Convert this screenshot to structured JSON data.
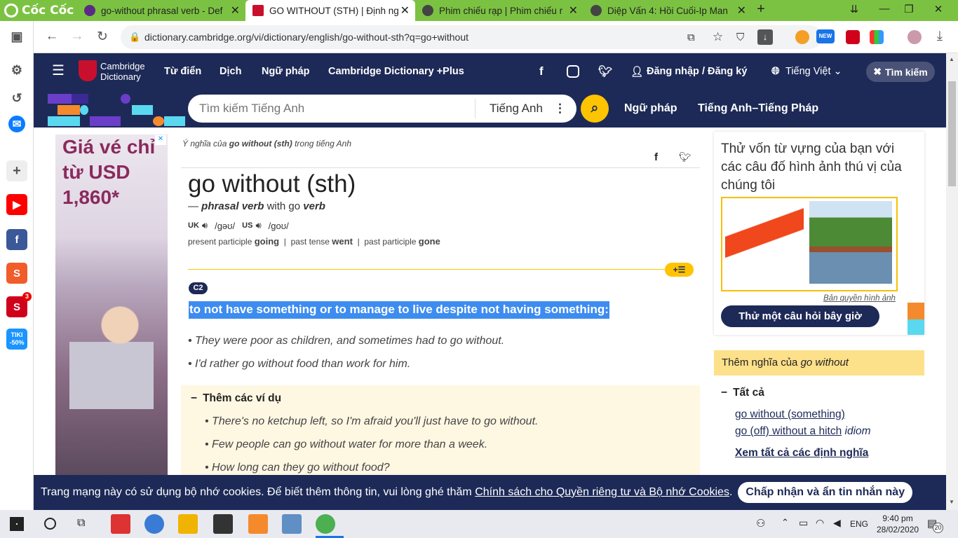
{
  "browser": {
    "brand": "Cốc Cốc",
    "tabs": [
      {
        "title": "go-without phrasal verb - Def"
      },
      {
        "title": "GO WITHOUT (STH) | Định ng"
      },
      {
        "title": "Phim chiếu rạp | Phim chiếu r"
      },
      {
        "title": "Diệp Vấn 4: Hồi Cuối-Ip Man"
      }
    ],
    "url": "dictionary.cambridge.org/vi/dictionary/english/go-without-sth?q=go+without",
    "ext_badge": "NEW"
  },
  "sidebar": {
    "shopee_badge": "3",
    "tiki_label": "TIKI",
    "tiki_discount": "-50%"
  },
  "header": {
    "logo_line1": "Cambridge",
    "logo_line2": "Dictionary",
    "nav": [
      "Từ điển",
      "Dịch",
      "Ngữ pháp",
      "Cambridge Dictionary +Plus"
    ],
    "login": "Đăng nhập / Đăng ký",
    "language": "Tiếng Việt",
    "close_search": "Tìm kiếm"
  },
  "search": {
    "placeholder": "Tìm kiếm Tiếng Anh",
    "lang": "Tiếng Anh",
    "links": [
      "Ngữ pháp",
      "Tiếng Anh–Tiếng Pháp"
    ]
  },
  "ad": {
    "line1": "Giá vé chỉ",
    "line2": "từ USD",
    "line3": "1,860*"
  },
  "entry": {
    "meaning_prefix": "Ý nghĩa của",
    "meaning_word": "go without (sth)",
    "meaning_suffix": "trong tiếng Anh",
    "headword": "go without (sth)",
    "pos_dash": "—",
    "pos": "phrasal verb",
    "pos_with": "with go",
    "pos_verb": "verb",
    "uk_label": "UK",
    "uk_ipa": "/ɡəʊ/",
    "us_label": "US",
    "us_ipa": "/ɡoʊ/",
    "forms": [
      {
        "label": "present participle",
        "value": "going"
      },
      {
        "label": "past tense",
        "value": "went"
      },
      {
        "label": "past participle",
        "value": "gone"
      }
    ],
    "level": "C2",
    "definition": "to not have something or to manage to live despite not having something:",
    "examples": [
      "They were poor as children, and sometimes had to go without.",
      "I'd rather go without food than work for him."
    ],
    "more_title": "Thêm các ví dụ",
    "more_examples": [
      "There's no ketchup left, so I'm afraid you'll just have to go without.",
      "Few people can go without water for more than a week.",
      "How long can they go without food?"
    ]
  },
  "right": {
    "quiz_text": "Thử vốn từ vựng của bạn với các câu đố hình ảnh thú vị của chúng tôi",
    "credit": "Bản quyền hình ảnh",
    "quiz_button": "Thử một câu hỏi bây giờ",
    "more_meanings_prefix": "Thêm nghĩa của",
    "more_meanings_word": "go without",
    "all_label": "Tất cả",
    "links": [
      "go without (something)",
      "go (off) without a hitch"
    ],
    "idiom": "idiom",
    "see_all": "Xem tất cả các định nghĩa"
  },
  "cookie": {
    "text": "Trang mạng này có sử dụng bộ nhớ cookies. Để biết thêm thông tin, vui lòng ghé thăm",
    "link": "Chính sách cho Quyền riêng tư và Bộ nhớ Cookies",
    "period": ".",
    "button": "Chấp nhận và ẩn tin nhắn này"
  },
  "taskbar": {
    "lang": "ENG",
    "time": "9:40 pm",
    "date": "28/02/2020",
    "notifications": "20"
  }
}
